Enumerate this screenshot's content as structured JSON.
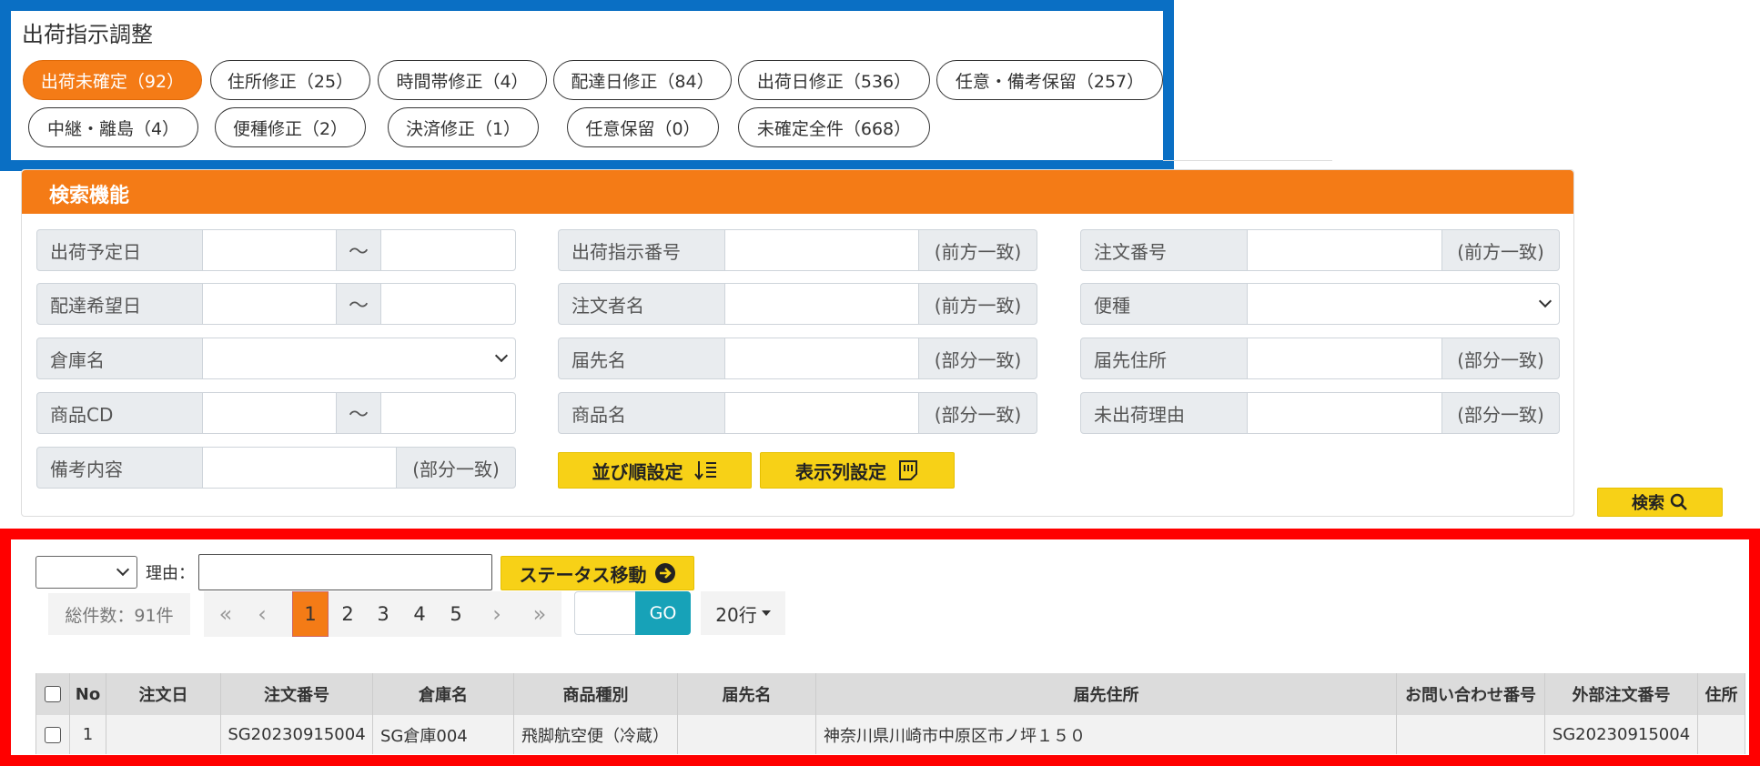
{
  "top": {
    "title": "出荷指示調整",
    "filters": [
      "出荷未確定（92）",
      "住所修正（25）",
      "時間帯修正（4）",
      "配達日修正（84）",
      "出荷日修正（536）",
      "任意・備考保留（257）",
      "中継・離島（4）",
      "便種修正（2）",
      "決済修正（1）",
      "任意保留（0）",
      "未確定全件（668）"
    ],
    "active_filter": "出荷未確定（92）"
  },
  "search": {
    "title": "検索機能",
    "tilde": "～",
    "ship_date_label": "出荷予定日",
    "delivery_date_label": "配達希望日",
    "warehouse_label": "倉庫名",
    "product_cd_label": "商品CD",
    "memo_label": "備考内容",
    "memo_suffix": "(部分一致)",
    "ship_instruction_no_label": "出荷指示番号",
    "ship_instruction_no_suffix": "(前方一致)",
    "orderer_name_label": "注文者名",
    "orderer_name_suffix": "(前方一致)",
    "recipient_name_label": "届先名",
    "recipient_name_suffix": "(部分一致)",
    "product_name_label": "商品名",
    "product_name_suffix": "(部分一致)",
    "order_no_label": "注文番号",
    "order_no_suffix": "(前方一致)",
    "shipping_type_label": "便種",
    "recipient_address_label": "届先住所",
    "recipient_address_suffix": "(部分一致)",
    "unshipped_reason_label": "未出荷理由",
    "unshipped_reason_suffix": "(部分一致)",
    "sort_button": "並び順設定",
    "columns_button": "表示列設定",
    "search_button": "検索"
  },
  "results": {
    "reason_label": "理由：",
    "status_move_button": "ステータス移動",
    "total": "総件数：91件",
    "pager": {
      "first": "«",
      "prev": "‹",
      "pages": [
        "1",
        "2",
        "3",
        "4",
        "5"
      ],
      "active_page": "1",
      "next": "›",
      "last": "»"
    },
    "go_button": "GO",
    "rows_per_page": "20行",
    "columns": [
      "No",
      "注文日",
      "注文番号",
      "倉庫名",
      "商品種別",
      "届先名",
      "届先住所",
      "お問い合わせ番号",
      "外部注文番号",
      "住所"
    ],
    "rows": [
      {
        "no": "1",
        "order_date": "",
        "order_no": "SG20230915004",
        "warehouse": "SG倉庫004",
        "product_type": "飛脚航空便（冷蔵）",
        "recipient": "",
        "address": "神奈川県川崎市中原区市ノ坪１５０",
        "inquiry_no": "",
        "external_order_no": "SG20230915004",
        "address_extra": ""
      }
    ]
  },
  "colors": {
    "accent_orange": "#f47b16",
    "highlight_blue": "#0a6fc4",
    "highlight_red": "#ff0000",
    "button_yellow": "#f7d117",
    "go_teal": "#17a2b8"
  }
}
